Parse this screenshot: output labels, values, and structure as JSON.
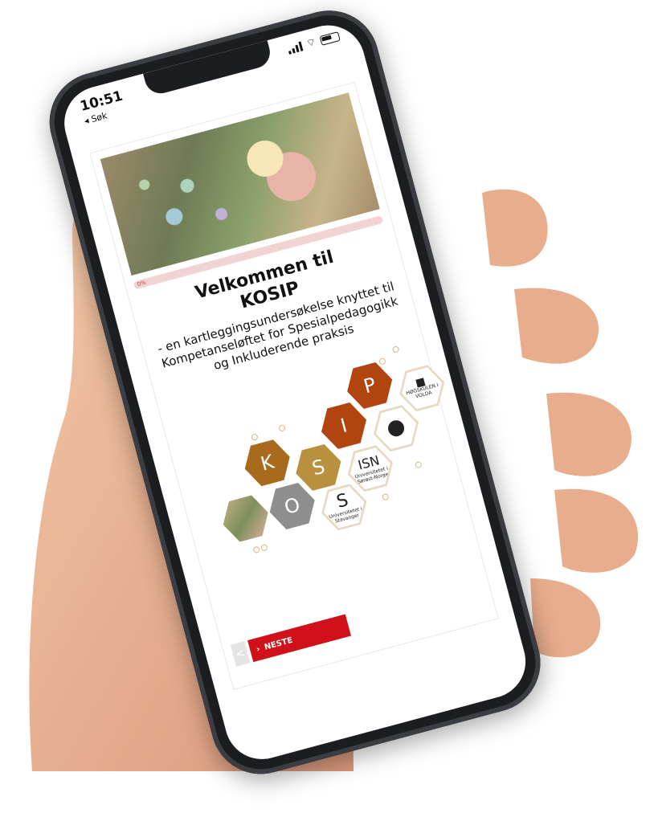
{
  "status_bar": {
    "time": "10:51",
    "back_label": "◂ Søk"
  },
  "survey": {
    "progress_label": "0%",
    "title_line1": "Velkommen til",
    "title_line2": "KOSIP",
    "description": "- en kartleggingsundersøkelse knyttet til Kompetanseløftet for Spesialpedagogikk og Inkluderende praksis",
    "logo_letters": [
      "K",
      "O",
      "S",
      "I",
      "P"
    ],
    "partner_logos": {
      "hvo": "HØGSKULEN I VOLDA",
      "usn": "Universitetet i Sørøst-Norge",
      "uis": "Universitetet i Stavanger"
    },
    "next_label": "NESTE",
    "prev_label": "<"
  },
  "colors": {
    "brand_red": "#d0111a",
    "hex_brown": "#a86a1c",
    "hex_gold": "#b8903e",
    "hex_rust": "#b2440f",
    "hex_grey": "#8e8e8e"
  }
}
